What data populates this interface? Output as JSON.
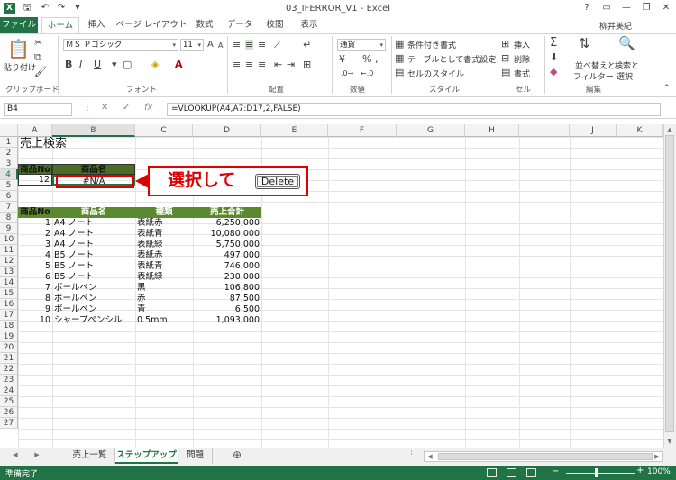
{
  "window": {
    "title": "03_IFERROR_V1 - Excel",
    "logo": "X",
    "quick_access": [
      "save-icon",
      "undo-icon",
      "redo-icon",
      "customize-icon"
    ],
    "controls": [
      "?",
      "▭",
      "—",
      "❐",
      "✕"
    ]
  },
  "tabs": [
    "ファイル",
    "ホーム",
    "挿入",
    "ページ レイアウト",
    "数式",
    "データ",
    "校閲",
    "表示"
  ],
  "user": "柳井美紀",
  "ribbon": {
    "clipboard": {
      "paste": "貼り付け",
      "label": "クリップボード"
    },
    "font": {
      "name": "ＭＳ Ｐゴシック",
      "size": "11",
      "label": "フォント",
      "bold": "B",
      "italic": "I",
      "underline": "U",
      "grow": "A",
      "shrink": "A"
    },
    "alignment": {
      "label": "配置"
    },
    "number": {
      "format": "通貨",
      "label": "数値",
      "percent": "%",
      "comma": ",",
      "currency": "¥"
    },
    "styles": {
      "conditional": "条件付き書式",
      "table": "テーブルとして書式設定",
      "cell": "セルのスタイル",
      "label": "スタイル"
    },
    "cells": {
      "insert": "挿入",
      "delete": "削除",
      "format": "書式",
      "label": "セル"
    },
    "editing": {
      "sort": "並べ替えと",
      "sort2": "フィルター",
      "find": "検索と",
      "find2": "選択",
      "label": "編集"
    }
  },
  "formula_bar": {
    "name_box": "B4",
    "fx": "fx",
    "formula": "=VLOOKUP(A4,A7:D17,2,FALSE)"
  },
  "grid": {
    "columns": [
      "A",
      "B",
      "C",
      "D",
      "E",
      "F",
      "G",
      "H",
      "I",
      "J",
      "K"
    ],
    "rows": [
      "1",
      "2",
      "3",
      "4",
      "5",
      "6",
      "7",
      "8",
      "9",
      "10",
      "11",
      "12",
      "13",
      "14",
      "15",
      "16",
      "17",
      "18",
      "19",
      "20",
      "21",
      "22",
      "23",
      "24",
      "25",
      "26",
      "27"
    ],
    "title": "売上検索",
    "search_header": [
      "商品No",
      "商品名"
    ],
    "search_row": [
      "12",
      "#N/A"
    ],
    "table_header": [
      "商品No",
      "商品名",
      "種類",
      "売上合計"
    ],
    "table_rows": [
      [
        "1",
        "A4 ノート",
        "表紙赤",
        "6,250,000"
      ],
      [
        "2",
        "A4 ノート",
        "表紙青",
        "10,080,000"
      ],
      [
        "3",
        "A4 ノート",
        "表紙緑",
        "5,750,000"
      ],
      [
        "4",
        "B5 ノート",
        "表紙赤",
        "497,000"
      ],
      [
        "5",
        "B5 ノート",
        "表紙青",
        "746,000"
      ],
      [
        "6",
        "B5 ノート",
        "表紙緑",
        "230,000"
      ],
      [
        "7",
        "ボールペン",
        "黒",
        "106,800"
      ],
      [
        "8",
        "ボールペン",
        "赤",
        "87,500"
      ],
      [
        "9",
        "ボールペン",
        "青",
        "6,500"
      ],
      [
        "10",
        "シャープペンシル",
        "0.5mm",
        "1,093,000"
      ]
    ]
  },
  "callout": {
    "text": "選択して",
    "key": "Delete"
  },
  "sheets": [
    "売上一覧",
    "ステップアップ",
    "問題"
  ],
  "active_sheet": "ステップアップ",
  "add_sheet": "⊕",
  "status": {
    "ready": "準備完了",
    "zoom": "100%"
  },
  "colors": {
    "excel_green": "#217346",
    "header_fill": "#5b8a2e",
    "callout_red": "#e00000"
  }
}
